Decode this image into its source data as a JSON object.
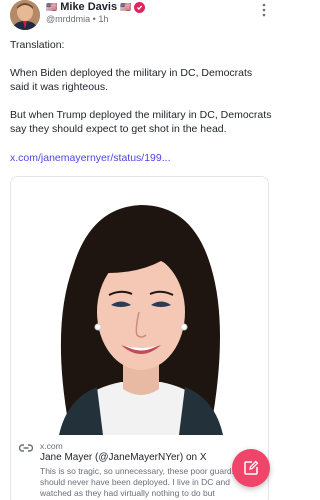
{
  "post": {
    "author": {
      "name": "Mike Davis",
      "flag_left": "🇺🇸",
      "flag_right": "🇺🇸",
      "handle": "@mrddmia",
      "separator": "•",
      "age": "1h",
      "verified_badge_color": "#e0245e"
    },
    "text": [
      "Translation:",
      "When Biden deployed the military in DC, Democrats said it was righteous.",
      "But when Trump deployed the military in DC, Democrats say they should expect to get shot in the head."
    ],
    "link": "x.com/janemayernyer/status/199..."
  },
  "link_card": {
    "domain": "x.com",
    "title": "Jane Mayer (@JaneMayerNYer) on X",
    "description": "This is so tragic, so unnecessary, these poor guardsmen should never have been deployed. I live in DC and watched as they had virtually nothing to do but"
  },
  "icons": {
    "more": "more-vertical-icon",
    "link": "link-icon",
    "compose": "compose-icon"
  },
  "colors": {
    "accent": "#4f46e5",
    "fab": "#f0456a"
  }
}
